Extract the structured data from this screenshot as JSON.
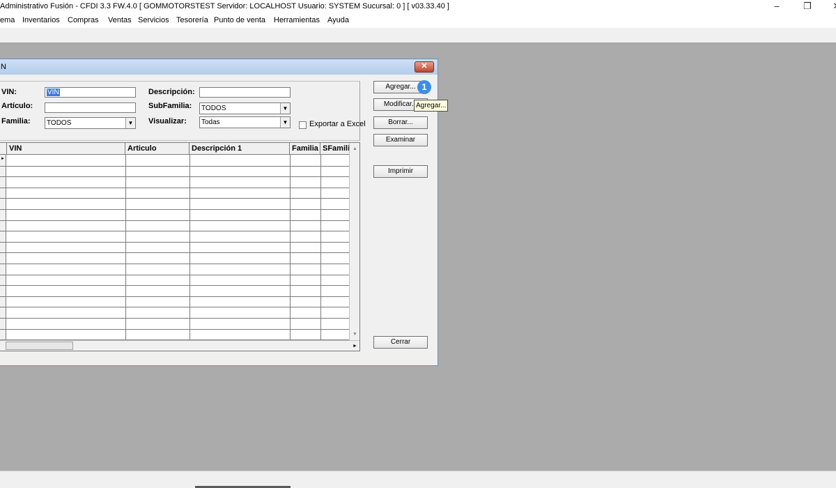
{
  "window": {
    "title": "Administrativo Fusión - CFDI 3.3 FW.4.0 [ GOMMOTORSTEST  Servidor: LOCALHOST   Usuario: SYSTEM    Sucursal: 0 ] [ v03.33.40 ]",
    "minimize_symbol": "–",
    "restore_symbol": "❐",
    "close_symbol": "✕"
  },
  "menu": {
    "items": [
      "ema",
      "Inventarios",
      "Compras",
      "Ventas",
      "Servicios",
      "Tesorería",
      "Punto de venta",
      "Herramientas",
      "Ayuda"
    ]
  },
  "dialog": {
    "title": "N",
    "close_symbol": "✕",
    "filters": {
      "vin_label": "VIN:",
      "vin_value": "VIN",
      "articulo_label": "Artículo:",
      "articulo_value": "",
      "familia_label": "Familia:",
      "familia_value": "TODOS",
      "descripcion_label": "Descripción:",
      "descripcion_value": "",
      "subfamilia_label": "SubFamilia:",
      "subfamilia_value": "TODOS",
      "visualizar_label": "Visualizar:",
      "visualizar_value": "Todas",
      "exportar_label": "Exportar a Excel",
      "exportar_checked": false
    },
    "grid": {
      "columns": [
        "VIN",
        "Articulo",
        "Descripción 1",
        "Familia",
        "SFamilia"
      ],
      "row_marker": "►",
      "rows": []
    },
    "buttons": {
      "agregar": "Agregar...",
      "modificar": "Modificar...",
      "borrar": "Borrar...",
      "examinar": "Examinar",
      "imprimir": "Imprimir",
      "cerrar": "Cerrar"
    },
    "badge": "1",
    "tooltip": "Agregar..."
  },
  "icons": {
    "dropdown": "chevron-down-icon",
    "scroll_up": "arrow-up-icon",
    "scroll_down": "arrow-down-icon",
    "scroll_right": "arrow-right-icon"
  },
  "colors": {
    "desktop": "#ababab",
    "title_gradient": "#b4cde9",
    "close_button": "#c0452c",
    "selection": "#3d7ad8",
    "badge": "#3a8ee6",
    "tooltip_bg": "#ffffe1"
  }
}
